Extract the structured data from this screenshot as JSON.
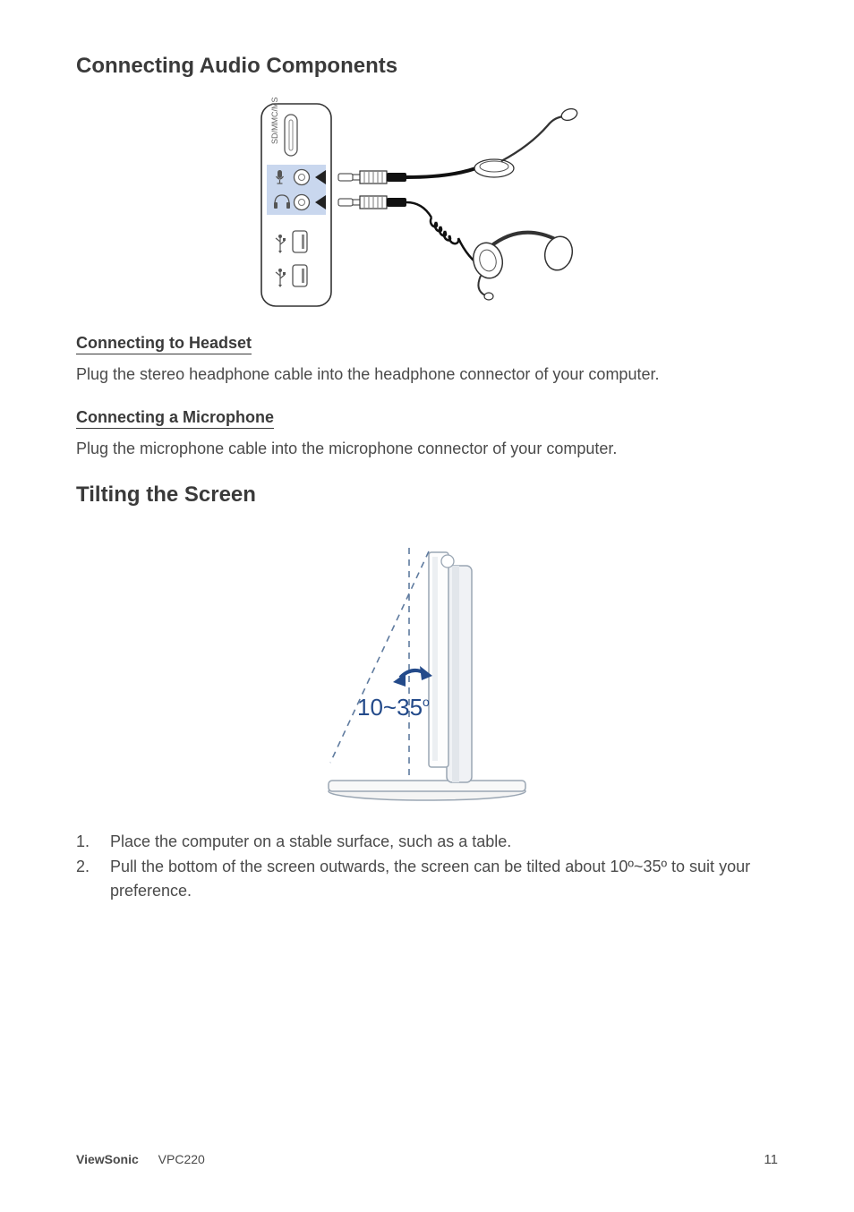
{
  "headings": {
    "h1_audio": "Connecting Audio Components",
    "h1_tilt": "Tilting the Screen"
  },
  "sub": {
    "headset": "Connecting to Headset",
    "mic": "Connecting a Microphone"
  },
  "body": {
    "headset": "Plug the stereo headphone cable into the headphone connector of your computer.",
    "mic": "Plug the microphone cable into the microphone connector of your computer."
  },
  "list": {
    "n1": "1.",
    "t1": "Place the computer on a stable surface, such as a table.",
    "n2": "2.",
    "t2": "Pull the bottom of the screen outwards, the screen can be tilted about 10º~35º to suit your preference."
  },
  "figure": {
    "ports_label": "SD/MMC/MS",
    "tilt_label": "10~35",
    "tilt_deg": "o"
  },
  "footer": {
    "brand": "ViewSonic",
    "model": "VPC220",
    "page": "11"
  }
}
